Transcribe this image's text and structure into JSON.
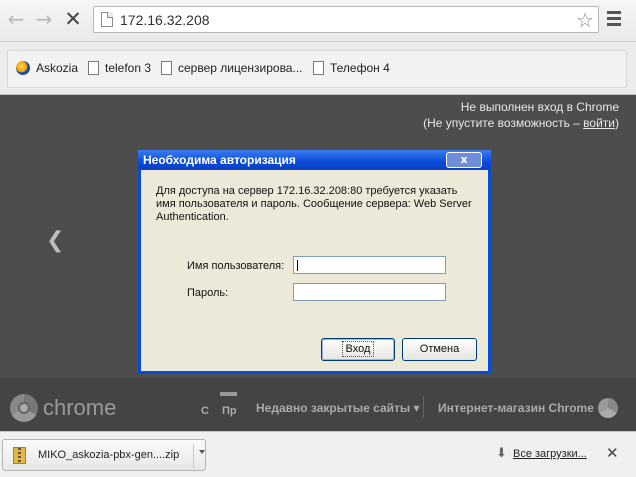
{
  "toolbar": {
    "back_icon": "back-arrow-icon",
    "forward_icon": "forward-arrow-icon",
    "stop_icon": "stop-x-icon",
    "url": "172.16.32.208",
    "star_icon": "star-icon",
    "menu_icon": "hamburger-menu-icon"
  },
  "bookmarks": [
    {
      "label": "Askozia",
      "icon": "askozia-logo-icon"
    },
    {
      "label": "telefon 3",
      "icon": "page-icon"
    },
    {
      "label": "сервер лицензирова...",
      "icon": "page-icon"
    },
    {
      "label": "Телефон 4",
      "icon": "page-icon"
    }
  ],
  "page": {
    "signin_line1": "Не выполнен вход в Chrome",
    "signin_line2_prefix": "(Не упустите возможность – ",
    "signin_link": "войти",
    "signin_line2_suffix": ")",
    "chrome_word": "chrome",
    "thumb_labels": [
      "С",
      "Пр"
    ],
    "recently_closed": "Недавно закрытые сайты ▾",
    "web_store": "Интернет-магазин Chrome"
  },
  "dialog": {
    "title": "Необходима авторизация",
    "close_glyph": "x",
    "message": "Для доступа на сервер 172.16.32.208:80 требуется указать имя пользователя и пароль. Сообщение сервера: Web Server Authentication.",
    "username_label": "Имя пользователя:",
    "password_label": "Пароль:",
    "username_value": "",
    "password_value": "",
    "ok_label": "Вход",
    "cancel_label": "Отмена"
  },
  "downloads": {
    "file_name": "MIKO_askozia-pbx-gen....zip",
    "all_downloads": "Все загрузки...",
    "close_glyph": "✕"
  },
  "colors": {
    "dialog_title_bar": "#0a4bd8",
    "dialog_body": "#ece9d8",
    "page_background": "#4d4d4d"
  }
}
